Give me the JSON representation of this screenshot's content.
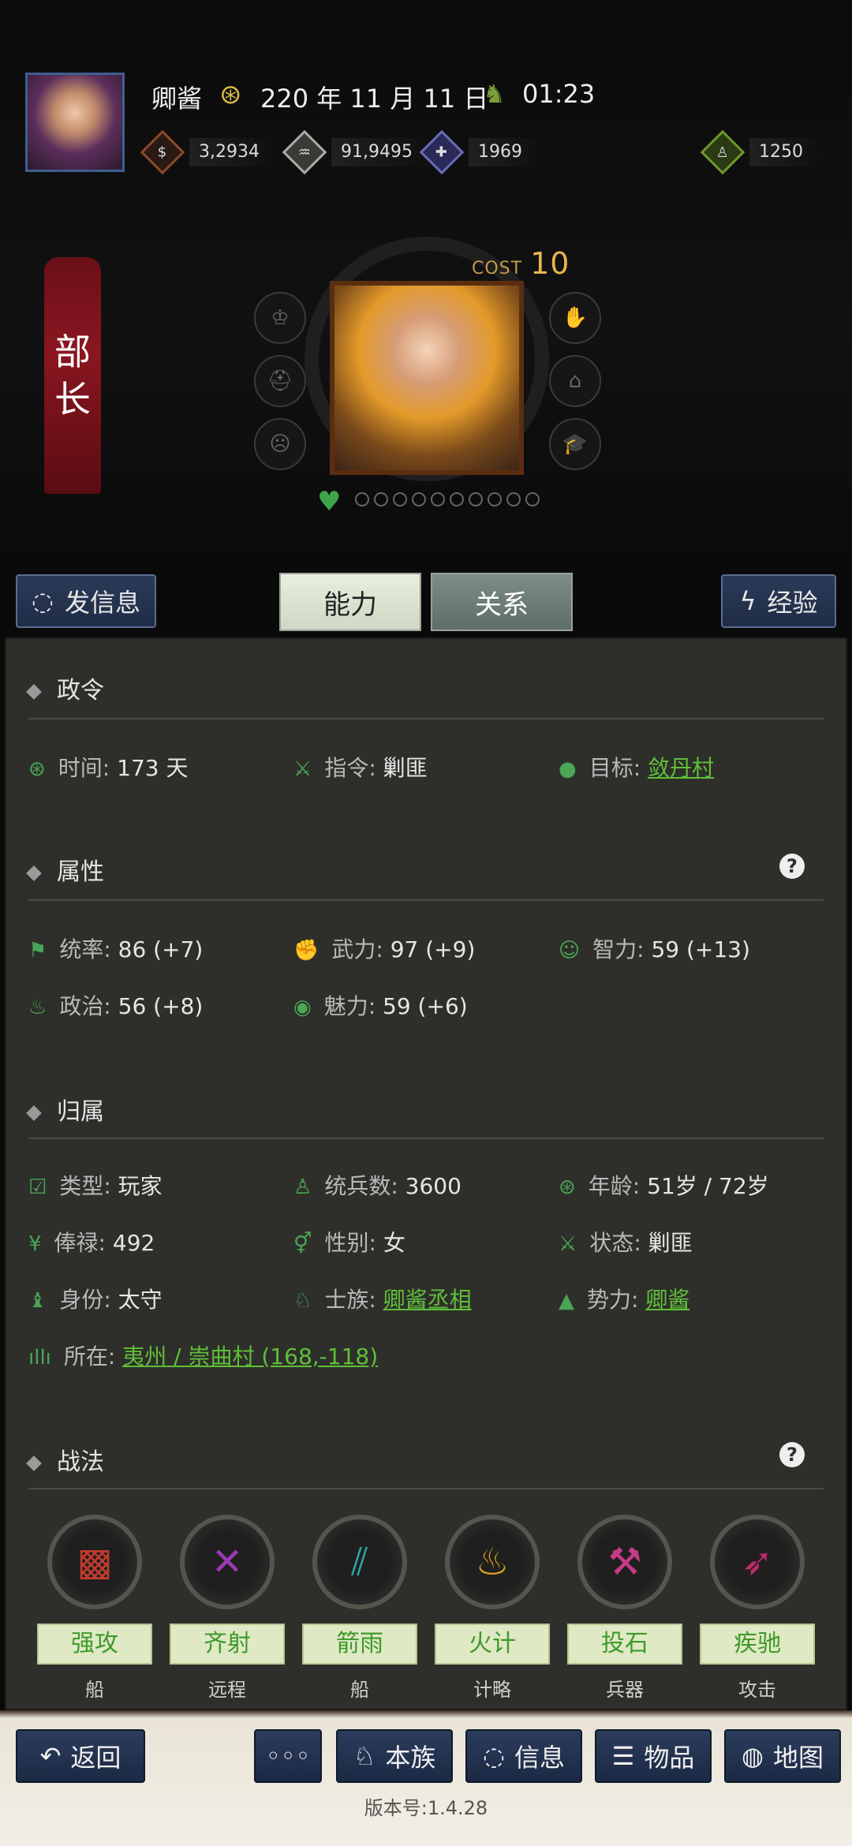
{
  "header": {
    "name": "卿酱",
    "date": "220 年 11 月 11 日",
    "time": "01:23",
    "resources": [
      {
        "icon": "coin-icon",
        "value": "3,2934",
        "color": "#8a4a2a"
      },
      {
        "icon": "grain-icon",
        "value": "91,9495",
        "color": "#9a9a8a"
      },
      {
        "icon": "soldier-icon",
        "value": "1969",
        "color": "#5a5aa0"
      },
      {
        "icon": "bag-icon",
        "value": "1250",
        "color": "#5a8a2a"
      }
    ]
  },
  "banner": {
    "char1": "部",
    "char2": "长"
  },
  "portrait": {
    "cost_label": "COST",
    "cost_value": "10"
  },
  "actions": {
    "message": "发信息",
    "ability": "能力",
    "relation": "关系",
    "exp": "经验"
  },
  "sections": {
    "zhengling": {
      "title": "政令",
      "time_k": "时间:",
      "time_v": "173 天",
      "order_k": "指令:",
      "order_v": "剿匪",
      "target_k": "目标:",
      "target_v": "敛丹村"
    },
    "attrs": {
      "title": "属性",
      "tongshuai_k": "统率:",
      "tongshuai_v": "86 (+7)",
      "wuli_k": "武力:",
      "wuli_v": "97 (+9)",
      "zhili_k": "智力:",
      "zhili_v": "59 (+13)",
      "zhengzhi_k": "政治:",
      "zhengzhi_v": "56 (+8)",
      "meili_k": "魅力:",
      "meili_v": "59 (+6)"
    },
    "belong": {
      "title": "归属",
      "type_k": "类型:",
      "type_v": "玩家",
      "troops_k": "统兵数:",
      "troops_v": "3600",
      "age_k": "年龄:",
      "age_v": "51岁 / 72岁",
      "salary_k": "俸禄:",
      "salary_v": "492",
      "gender_k": "性别:",
      "gender_v": "女",
      "state_k": "状态:",
      "state_v": "剿匪",
      "rank_k": "身份:",
      "rank_v": "太守",
      "clan_k": "士族:",
      "clan_v": "卿酱丞相",
      "force_k": "势力:",
      "force_v": "卿酱",
      "loc_k": "所在:",
      "loc_v": "夷州 / 崇曲村 (168,-118)"
    },
    "tactics": {
      "title": "战法",
      "items": [
        {
          "name": "强攻",
          "type": "船",
          "color": "#c23a2e"
        },
        {
          "name": "齐射",
          "type": "远程",
          "color": "#9a3ab0"
        },
        {
          "name": "箭雨",
          "type": "船",
          "color": "#2aa6a0"
        },
        {
          "name": "火计",
          "type": "计略",
          "color": "#d8a020"
        },
        {
          "name": "投石",
          "type": "兵器",
          "color": "#c83a8a"
        },
        {
          "name": "疾驰",
          "type": "攻击",
          "color": "#c02a6a"
        }
      ]
    }
  },
  "nav": {
    "back": "返回",
    "more": "◦◦◦",
    "clan": "本族",
    "info": "信息",
    "items": "物品",
    "map": "地图"
  },
  "version": "版本号:1.4.28"
}
